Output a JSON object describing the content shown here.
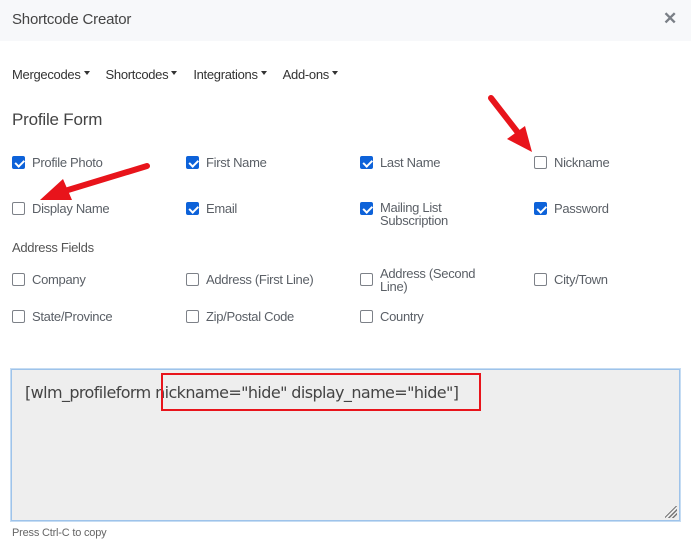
{
  "header": {
    "title": "Shortcode Creator",
    "close_icon": "close-icon"
  },
  "menu": [
    {
      "label": "Mergecodes"
    },
    {
      "label": "Shortcodes"
    },
    {
      "label": "Integrations"
    },
    {
      "label": "Add-ons"
    }
  ],
  "profile_form": {
    "title": "Profile Form",
    "fields": [
      {
        "label": "Profile Photo",
        "checked": true
      },
      {
        "label": "First Name",
        "checked": true
      },
      {
        "label": "Last Name",
        "checked": true
      },
      {
        "label": "Nickname",
        "checked": false
      },
      {
        "label": "Display Name",
        "checked": false
      },
      {
        "label": "Email",
        "checked": true
      },
      {
        "label": "Mailing List Subscription",
        "checked": true
      },
      {
        "label": "Password",
        "checked": true
      }
    ]
  },
  "address_fields": {
    "title": "Address Fields",
    "fields": [
      {
        "label": "Company",
        "checked": false
      },
      {
        "label": "Address (First Line)",
        "checked": false
      },
      {
        "label": "Address (Second Line)",
        "checked": false
      },
      {
        "label": "City/Town",
        "checked": false
      },
      {
        "label": "State/Province",
        "checked": false
      },
      {
        "label": "Zip/Postal Code",
        "checked": false
      },
      {
        "label": "Country",
        "checked": false
      }
    ]
  },
  "output": {
    "value": "[wlm_profileform nickname=\"hide\" display_name=\"hide\"]",
    "hint": "Press Ctrl-C to copy"
  },
  "annotations": {
    "highlight_color": "#e8141b",
    "arrows": [
      "arrow-to-nickname",
      "arrow-to-display-name"
    ]
  },
  "colors": {
    "checkbox_accent": "#0d62d9",
    "header_bg": "#f7f8fa",
    "textarea_bg": "#eeeeee"
  }
}
